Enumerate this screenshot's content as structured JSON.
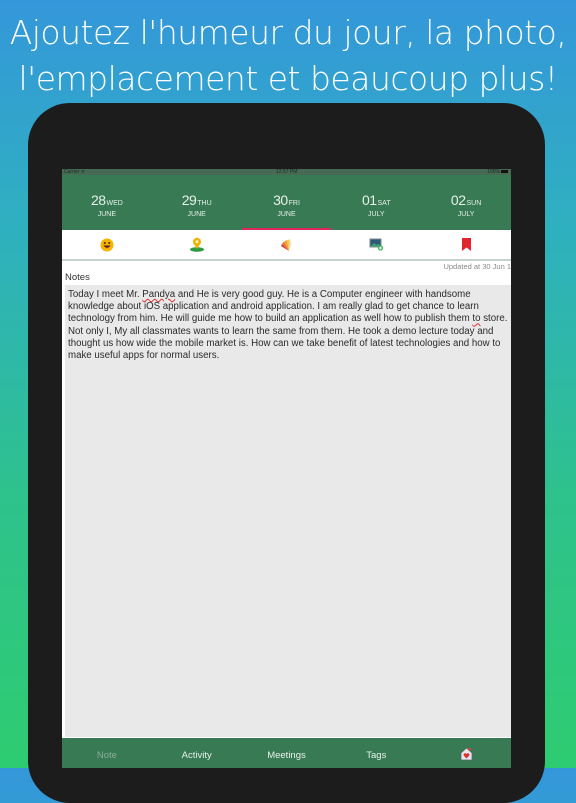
{
  "headline": {
    "line1": "Ajoutez l'humeur du jour, la photo,",
    "line2": "l'emplacement et beaucoup plus!"
  },
  "statusbar": {
    "carrier": "Carrier ᯤ",
    "time": "12:57 PM",
    "battery": "100%"
  },
  "dates": [
    {
      "day": "28",
      "dow": "WED",
      "month": "JUNE",
      "active": false
    },
    {
      "day": "29",
      "dow": "THU",
      "month": "JUNE",
      "active": false
    },
    {
      "day": "30",
      "dow": "FRI",
      "month": "JUNE",
      "active": true
    },
    {
      "day": "01",
      "dow": "SAT",
      "month": "JULY",
      "active": false
    },
    {
      "day": "02",
      "dow": "SUN",
      "month": "JULY",
      "active": false
    }
  ],
  "toolbar_icons": [
    "mood-emoji-icon",
    "location-pin-icon",
    "color-palette-icon",
    "add-photo-icon",
    "bookmark-icon"
  ],
  "updated_text": "Updated at 30 Jun 1",
  "notes": {
    "label": "Notes",
    "text_before": "Today I meet Mr. ",
    "misspelled_1": "Pandya",
    "text_middle": " and He is very good guy. He is a Computer engineer with handsome knowledge about iOS application and android application. I am really glad to get chance to learn technology from him.  He will guide me how to build an application as well how to publish them ",
    "misspelled_2": "to",
    "text_after": " store. Not only I, My all classmates wants to learn the same from them. He took a demo lecture today and thought us how wide the mobile market is. How can we take benefit of latest technologies and how to make useful apps for normal users."
  },
  "tabs": [
    {
      "label": "Note",
      "active": true
    },
    {
      "label": "Activity",
      "active": false
    },
    {
      "label": "Meetings",
      "active": false
    },
    {
      "label": "Tags",
      "active": false
    }
  ],
  "tab_last_icon": "home-heart-icon",
  "colors": {
    "accent_green": "#377a53",
    "active_underline": "#e0245e",
    "notes_bg": "#e9e9e9"
  }
}
